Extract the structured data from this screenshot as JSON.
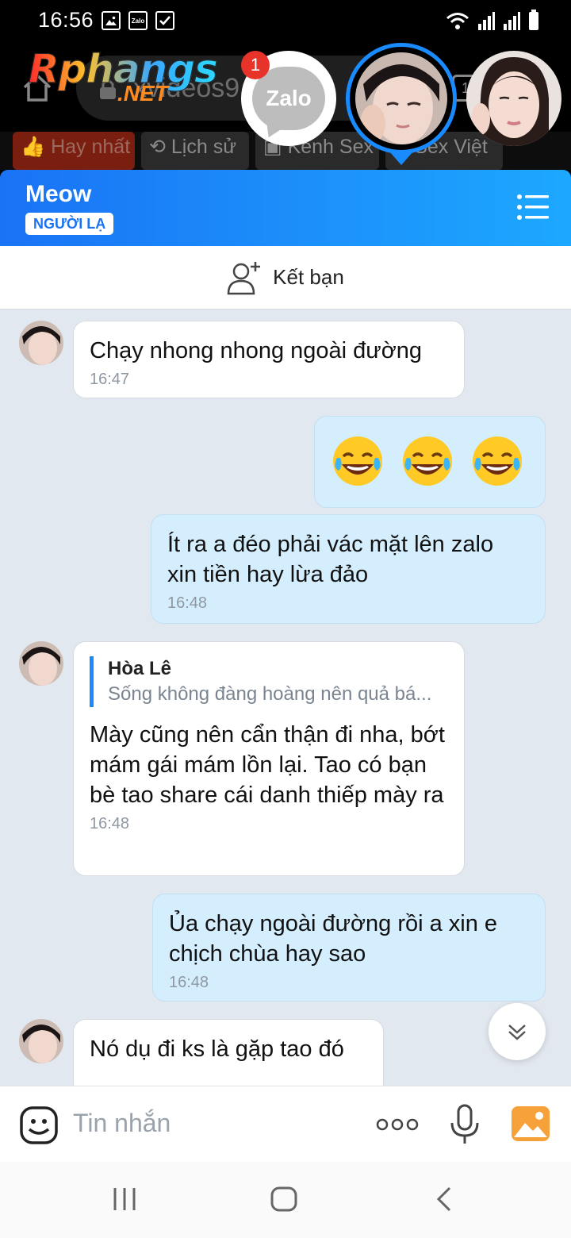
{
  "status_bar": {
    "time": "16:56",
    "left_icons": [
      "image-icon",
      "zalo-notification-icon",
      "check-box-icon"
    ],
    "zalo_mini_label": "Zalo",
    "right_icons": [
      "wifi-icon",
      "signal-icon",
      "signal-icon",
      "battery-icon"
    ]
  },
  "browser": {
    "url_text": "xvideos9",
    "tab_count": "1",
    "logo_main": "Rphangs",
    "logo_suffix": ".NET",
    "categories": [
      {
        "label": "Hay nhất",
        "icon": "thumbs-up-icon"
      },
      {
        "label": "Lịch sử",
        "icon": "history-icon"
      },
      {
        "label": "Kênh Sex",
        "icon": "video-icon"
      },
      {
        "label": "Sex Việt",
        "icon": "tag-icon"
      }
    ]
  },
  "chat_heads": {
    "zalo_label": "Zalo",
    "unread_badge": "1"
  },
  "chat": {
    "contact_name": "Meow",
    "stranger_badge": "NGƯỜI LẠ",
    "add_friend_label": "Kết bạn",
    "messages": [
      {
        "direction": "in",
        "text": "Chạy nhong nhong ngoài đường",
        "time": "16:47"
      },
      {
        "direction": "out",
        "emoji": [
          "😂",
          "😂",
          "😂"
        ]
      },
      {
        "direction": "out",
        "text": "Ít ra a đéo phải vác mặt lên zalo xin tiền hay lừa đảo",
        "time": "16:48"
      },
      {
        "direction": "in",
        "quote_name": "Hòa Lê",
        "quote_text": "Sống không đàng hoàng nên quả bá...",
        "text": "Mày cũng nên cẩn thận đi nha, bớt mám gái mám lồn lại. Tao có bạn bè tao share cái danh thiếp mày ra",
        "time": "16:48"
      },
      {
        "direction": "out",
        "text": "Ủa chạy ngoài đường rồi a xin e chịch chùa hay sao",
        "time": "16:48"
      },
      {
        "direction": "in",
        "text": "Nó dụ đi ks là gặp tao đó"
      }
    ]
  },
  "composer": {
    "placeholder": "Tin nhắn"
  },
  "colors": {
    "header_gradient_start": "#1a73f5",
    "header_gradient_end": "#1da8ff",
    "outgoing_bubble": "#d5eefe",
    "incoming_bubble": "#ffffff",
    "chat_background": "#e2e8ef",
    "badge_red": "#e8332a"
  }
}
